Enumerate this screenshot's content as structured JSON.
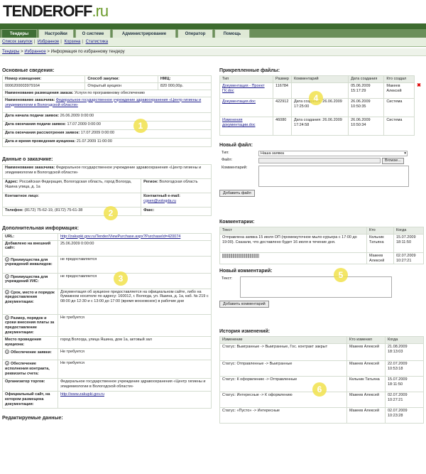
{
  "header": {
    "logo_main": "TENDEROFF",
    "logo_suffix": ".ru"
  },
  "tabs": [
    "Тендеры",
    "Настройки",
    "О системе",
    "Администрирование",
    "Оператор",
    "Помощь"
  ],
  "subnav": {
    "items": [
      "Список закупок",
      "Избранное",
      "Корзина",
      "Статистика"
    ]
  },
  "breadcrumb": {
    "a": "Тендеры",
    "b": "Избранное",
    "current": "Информация по избранному тендеру"
  },
  "basic": {
    "title": "Основные сведения:",
    "order_label": "Номер извещения:",
    "order_value": "0006200003979164",
    "method_label": "Способ закупки:",
    "method_value": "Открытый аукцион",
    "price_label": "НМЦ:",
    "price_value": "820 000,00р.",
    "subject_label": "Наименование размещения заказа:",
    "subject_value": "Услуги по программному обеспечению",
    "customer_label": "Наименование заказчика:",
    "customer_value": "Федеральное государственное учреждение здравоохранения «Центр гигиены и эпидемиологии в Вологодской области»",
    "start_label": "Дата начала подачи заявок:",
    "start_value": "26.06.2009 0:00:00",
    "end_label": "Дата окончания подачи заявок:",
    "end_value": "17.07.2009 0:00:00",
    "review_label": "Дата окончания рассмотрения заявок:",
    "review_value": "17.07.2009 0:00:00",
    "auction_label": "Дата и время проведения аукциона:",
    "auction_value": "21.07.2009 11:00:00"
  },
  "customer": {
    "title": "Данные о заказчике:",
    "name_label": "Наименование заказчика:",
    "name_value": "Федеральное государственное учреждение здравоохранения «Центр гигиены и эпидемиологии в Вологодской области»",
    "address_label": "Адрес:",
    "address_value": "Российская Федерация, Вологодская область, город Вологда, Яшина улица, д. 1а",
    "region_label": "Регион:",
    "region_value": "Вологодская область",
    "contact_label": "Контактное лицо:",
    "email_label": "Контактный e-mail:",
    "email_value": "cgsen@vologda.ru",
    "phone_label": "Телефон:",
    "phone_value": "(8172) 75-62-19, (8172) 75-61-38",
    "fax_label": "Факс:"
  },
  "extra": {
    "title": "Дополнительная информация:",
    "url_label": "URL:",
    "url_value": "http://zakupki.gov.ru/Tender/ViewPurchase.aspx?PurchaseId=420074",
    "added_label": "Добавлено на внешний сайт:",
    "added_value": "25.06.2009 0:00:00",
    "disabled_label": "Преимущества для учреждений инвалидов:",
    "disabled_value": "не предоставляется",
    "uis_label": "Преимущества для учреждений УИС:",
    "uis_value": "не предоставляется",
    "docs_label": "Срок, место и порядок предоставления документации:",
    "docs_value": "Документация об аукционе предоставляется на официальном сайте, либо на бумажном носителе по адресу: 160012, г. Вологда, ул. Яшина, д. 1а, каб. № 219 с 08:00 до 12:30 и с 13:00 до 17:00 (время московское) в рабочие дни",
    "fee_label": "Размер, порядок и сроки внесения платы за предоставление документации:",
    "fee_value": "Не требуется",
    "place_label": "Место проведения аукциона:",
    "place_value": "город Вологда, улица Яшина, дом 1а, актовый зал",
    "secure_label": "Обеспечение заявки:",
    "secure_value": "Не требуется",
    "contract_label": "Обеспечение исполнения контракта, реквизиты счета:",
    "contract_value": "Не требуется",
    "org_label": "Организатор торгов:",
    "org_value": "Федеральное государственное учреждение здравоохранения «Центр гигиены и эпидемиологии в Вологодской области»",
    "site_label": "Официальный сайт, на котором размещена документация:",
    "site_value": "http://www.zakupki.gov.ru"
  },
  "editable": {
    "title": "Редактируемые данные:"
  },
  "files": {
    "title": "Прикрепленные файлы:",
    "headers": [
      "Тип",
      "Размер",
      "Комментарий",
      "Дата создания",
      "Кто создал"
    ],
    "rows": [
      {
        "name": "Документация - Проект ГК.doc",
        "size": "116784",
        "comment": "",
        "date": "05.06.2009 15:17:29",
        "author": "Макеев Алексей"
      },
      {
        "name": "Документация.doc",
        "size": "422912",
        "comment": "Дата создания: 26.06.2009 17:25:00",
        "date": "26.06.2009 10:50:35",
        "author": "Система"
      },
      {
        "name": "Изменения документации.doc",
        "size": "46080",
        "comment": "Дата создания: 26.06.2009 17:24:58",
        "date": "26.06.2009 10:50:34",
        "author": "Система"
      }
    ]
  },
  "newfile": {
    "title": "Новый файл:",
    "type_label": "Тип:",
    "type_value": "Наша заявка",
    "file_label": "Файл:",
    "browse": "Browse...",
    "comment_label": "Комментарий:",
    "submit": "Добавить файл"
  },
  "comments": {
    "title": "Комментарии:",
    "headers": [
      "Текст",
      "Кто",
      "Когда"
    ],
    "rows": [
      {
        "text": "Отправлена заявка 15 июля ОП (промежуточное мыло курьера с 17:00 до 19:00). Сказали, что доставлено будет 16 июля в течение дня.",
        "who": "Кельник Татьяна",
        "when": "15.07.2009 18:11:50"
      },
      {
        "text": "",
        "who": "Макеев Алексей",
        "when": "02.07.2009 10:27:21"
      }
    ]
  },
  "newcomment": {
    "title": "Новый комментарий:",
    "text_label": "Текст:",
    "submit": "Добавить комментарий"
  },
  "history": {
    "title": "История изменений:",
    "headers": [
      "Изменение",
      "Кто изменил",
      "Когда"
    ],
    "rows": [
      {
        "text": "Статус: Выигранные -> Выигранные, Гос. контракт закрыт",
        "who": "Макеев Алексей",
        "when": "21.08.2009 18:13:03"
      },
      {
        "text": "Статус: Отправленные -> Выигранные",
        "who": "Макеев Алексей",
        "when": "22.07.2009 10:53:18"
      },
      {
        "text": "Статус: К оформлению -> Отправленные",
        "who": "Кельник Татьяна",
        "when": "15.07.2009 18:11:50"
      },
      {
        "text": "Статус: Интересные -> К оформлению",
        "who": "Макеев Алексей",
        "when": "02.07.2009 10:27:21"
      },
      {
        "text": "Статус: «Пусто» -> Интересные",
        "who": "Макеев Алексей",
        "when": "02.07.2009 10:23:28"
      }
    ]
  },
  "badges": [
    "1",
    "2",
    "3",
    "4",
    "5",
    "6"
  ]
}
